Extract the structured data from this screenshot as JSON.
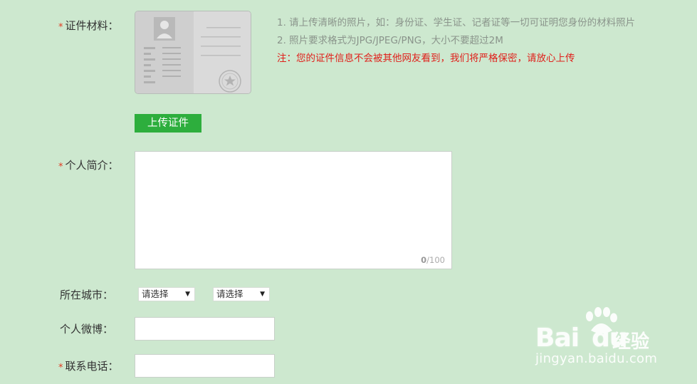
{
  "form": {
    "required_mark": "*",
    "cert": {
      "label": "证件材料：",
      "hints": [
        "1. 请上传清晰的照片，如：身份证、学生证、记者证等一切可证明您身份的材料照片",
        "2. 照片要求格式为JPG/JPEG/PNG，大小不要超过2M"
      ],
      "warning": "注：您的证件信息不会被其他网友看到，我们将严格保密，请放心上传",
      "upload_button": "上传证件"
    },
    "bio": {
      "label": "个人简介：",
      "value": "",
      "count": "0",
      "max": "/100"
    },
    "city": {
      "label": "所在城市：",
      "select1": "请选择",
      "select2": "请选择"
    },
    "weibo": {
      "label": "个人微博：",
      "value": ""
    },
    "phone": {
      "label": "联系电话：",
      "value": ""
    }
  },
  "watermark": {
    "logo": "Bai",
    "logo_du": "du",
    "brand": "经验",
    "url": "jingyan.baidu.com"
  },
  "colors": {
    "background": "#cde8cf",
    "required": "#e23a20",
    "warning": "#e0201b",
    "button": "#2dae3d",
    "hint": "#8a948b"
  }
}
